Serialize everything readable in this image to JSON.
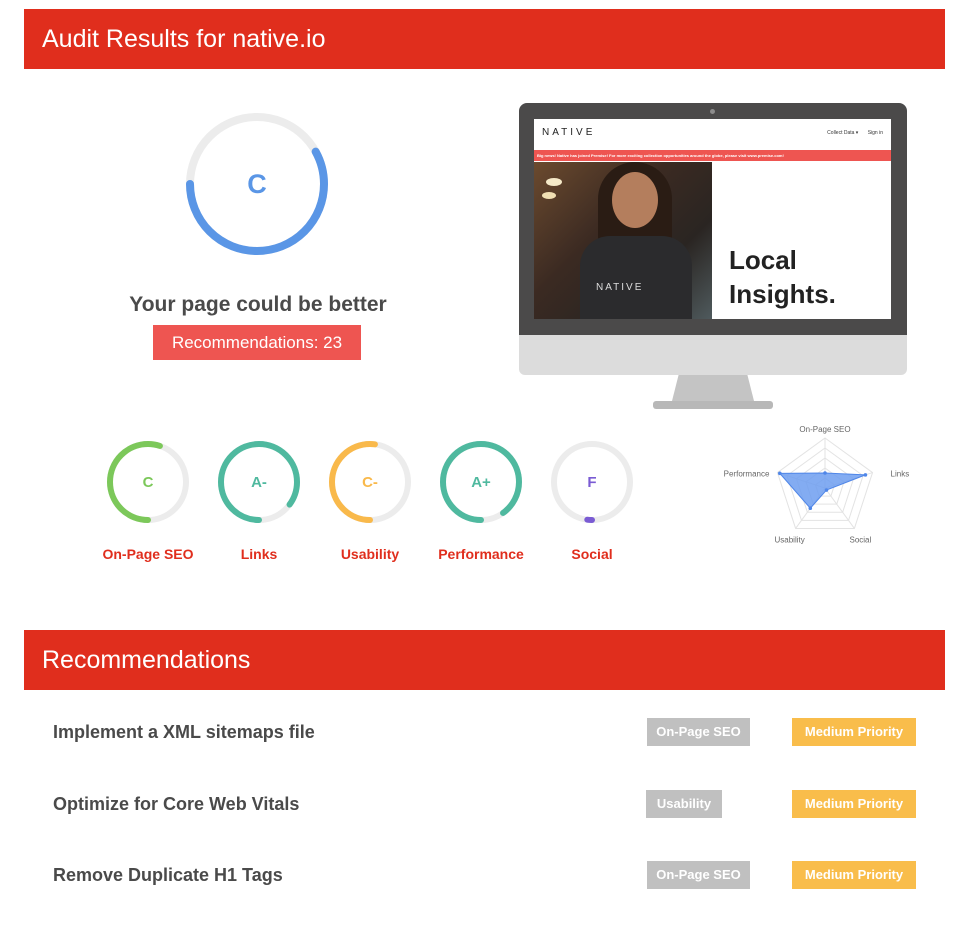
{
  "header": {
    "title": "Audit Results for native.io"
  },
  "overall": {
    "grade": "C",
    "progress": 0.58,
    "color": "#5a96e6",
    "verdict": "Your page could be better",
    "recommendations_label": "Recommendations: 23"
  },
  "preview": {
    "logo": "NATIVE",
    "nav_links": [
      "Collect Data ▾",
      "Sign in"
    ],
    "banner": "Big news! Native has joined Premise! For more exciting collection opportunities around the globe, please visit www.premise.com!",
    "shirt_text": "NATIVE",
    "headline_line1": "Local",
    "headline_line2": "Insights."
  },
  "categories": [
    {
      "name": "On-Page SEO",
      "grade": "C",
      "progress": 0.55,
      "color": "#7cc85a"
    },
    {
      "name": "Links",
      "grade": "A-",
      "progress": 0.85,
      "color": "#4fb99f"
    },
    {
      "name": "Usability",
      "grade": "C-",
      "progress": 0.52,
      "color": "#f9b94b"
    },
    {
      "name": "Performance",
      "grade": "A+",
      "progress": 0.9,
      "color": "#4fb99f"
    },
    {
      "name": "Social",
      "grade": "F",
      "progress": 0.02,
      "color": "#7a5bd3"
    }
  ],
  "radar": {
    "labels": [
      "On-Page SEO",
      "Links",
      "Social",
      "Usability",
      "Performance"
    ],
    "values": [
      0.3,
      0.85,
      0.05,
      0.5,
      0.95
    ],
    "fill": "#6d9df0"
  },
  "recommendations_header": "Recommendations",
  "recommendations": [
    {
      "title": "Implement a XML sitemaps file",
      "category": "On-Page SEO",
      "priority": "Medium Priority"
    },
    {
      "title": "Optimize for Core Web Vitals",
      "category": "Usability",
      "priority": "Medium Priority"
    },
    {
      "title": "Remove Duplicate H1 Tags",
      "category": "On-Page SEO",
      "priority": "Medium Priority"
    }
  ]
}
